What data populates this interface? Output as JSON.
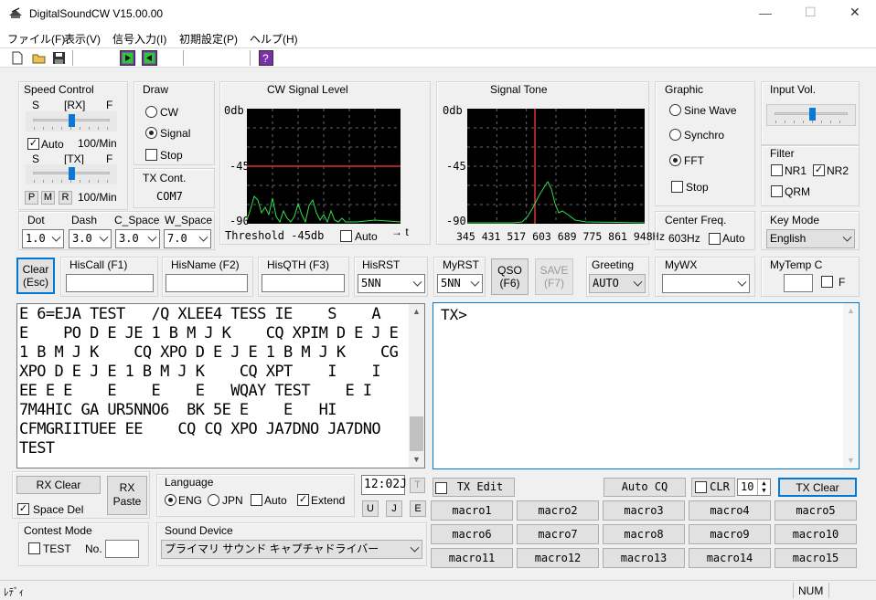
{
  "window": {
    "title": "DigitalSoundCW V15.00.00",
    "minimize": "—",
    "maximize": "☐",
    "close": "✕"
  },
  "menu": [
    "ファイル(F)",
    "表示(V)",
    "信号入力(I)",
    "初期設定(P)",
    "ヘルプ(H)"
  ],
  "speed_control": {
    "title": "Speed Control",
    "rx_s": "S",
    "rx_label": "[RX]",
    "rx_f": "F",
    "rx_value": 0.5,
    "auto_label": "Auto",
    "auto_checked": true,
    "rx_speed": "100/Min",
    "tx_s": "S",
    "tx_label": "[TX]",
    "tx_f": "F",
    "tx_value": 0.5,
    "pmr": [
      "P",
      "M",
      "R"
    ],
    "tx_speed": "100/Min"
  },
  "draw": {
    "title": "Draw",
    "cw": "CW",
    "signal": "Signal",
    "selected": "Signal",
    "stop": "Stop",
    "stop_checked": false
  },
  "tx_cont": {
    "title": "TX Cont.",
    "port": "COM7"
  },
  "cw_level": {
    "title": "CW Signal Level",
    "y_top": "0db",
    "y_mid": "-45",
    "y_bot": "-90",
    "threshold": "Threshold -45db",
    "auto": "Auto",
    "auto_checked": false,
    "arrow": "→ t"
  },
  "signal_tone": {
    "title": "Signal Tone",
    "y_top": "0db",
    "y_mid": "-45",
    "y_bot": "-90",
    "x_ticks": "345 431 517 603 689 775 861 948Hz"
  },
  "graphic": {
    "title": "Graphic",
    "options": [
      "Sine Wave",
      "Synchro",
      "FFT"
    ],
    "selected": "FFT",
    "stop": "Stop",
    "stop_checked": false
  },
  "input_vol": {
    "title": "Input Vol.",
    "value": 0.5
  },
  "filter": {
    "title": "Filter",
    "nr1": "NR1",
    "nr1_checked": false,
    "nr2": "NR2",
    "nr2_checked": true,
    "qrm": "QRM",
    "qrm_checked": false
  },
  "center_freq": {
    "title": "Center Freq.",
    "value": "603Hz",
    "auto": "Auto",
    "auto_checked": false
  },
  "key_mode": {
    "title": "Key Mode",
    "value": "English"
  },
  "timing": {
    "dot": "Dot",
    "dash": "Dash",
    "c_space": "C_Space",
    "w_space": "W_Space",
    "dot_v": "1.0",
    "dash_v": "3.0",
    "c_space_v": "3.0",
    "w_space_v": "7.0"
  },
  "qso": {
    "clear": "Clear",
    "clear_sub": "(Esc)",
    "hiscall": "HisCall (F1)",
    "hisname": "HisName (F2)",
    "hisqth": "HisQTH (F3)",
    "hisrst": "HisRST",
    "hisrst_v": "5NN",
    "myrst": "MyRST",
    "myrst_v": "5NN",
    "qso_btn": "QSO",
    "qso_sub": "(F6)",
    "save_btn": "SAVE",
    "save_sub": "(F7)",
    "greeting": "Greeting",
    "greeting_v": "AUTO",
    "mywx": "MyWX",
    "mywx_v": "",
    "mytemp": "MyTemp C",
    "f": "F"
  },
  "rx_text": "E 6=EJA TEST   /Q XLEE4 TESS IE    S    A\nE    PO D E JE 1 B M J K    CQ XPIM D E J E\n1 B M J K    CQ XPO D E J E 1 B M J K    CG\nXPO D E J E 1 B M J K    CQ XPT    I    I\nEE E E    E    E    E   WQAY TEST    E I\n7M4HIC GA UR5NNO6  BK 5E E    E   HI\nCFMGRIITUEE EE    CQ CQ XPO JA7DNO JA7DNO\nTEST",
  "tx_text": "TX>",
  "rx_controls": {
    "rx_clear": "RX Clear",
    "rx_paste_1": "RX",
    "rx_paste_2": "Paste",
    "space_del": "Space Del",
    "space_del_checked": true
  },
  "language": {
    "title": "Language",
    "eng": "ENG",
    "jpn": "JPN",
    "selected": "ENG",
    "auto": "Auto",
    "auto_checked": false,
    "extend": "Extend",
    "extend_checked": true
  },
  "clock": {
    "time": "12:02J",
    "t": "T",
    "u": "U",
    "j": "J",
    "e": "E"
  },
  "contest": {
    "title": "Contest Mode",
    "test": "TEST",
    "test_checked": false,
    "no": "No."
  },
  "sound_device": {
    "title": "Sound Device",
    "value": "プライマリ サウンド キャプチャドライバー"
  },
  "tx_controls": {
    "tx_edit": "TX Edit",
    "tx_edit_checked": false,
    "auto_cq": "Auto CQ",
    "clr": "CLR",
    "clr_checked": false,
    "clr_value": "10",
    "tx_clear": "TX Clear"
  },
  "macros": [
    "macro1",
    "macro2",
    "macro3",
    "macro4",
    "macro5",
    "macro6",
    "macro7",
    "macro8",
    "macro9",
    "macro10",
    "macro11",
    "macro12",
    "macro13",
    "macro14",
    "macro15"
  ],
  "status": {
    "left": "ﾚﾃﾞｨ",
    "num": "NUM"
  }
}
